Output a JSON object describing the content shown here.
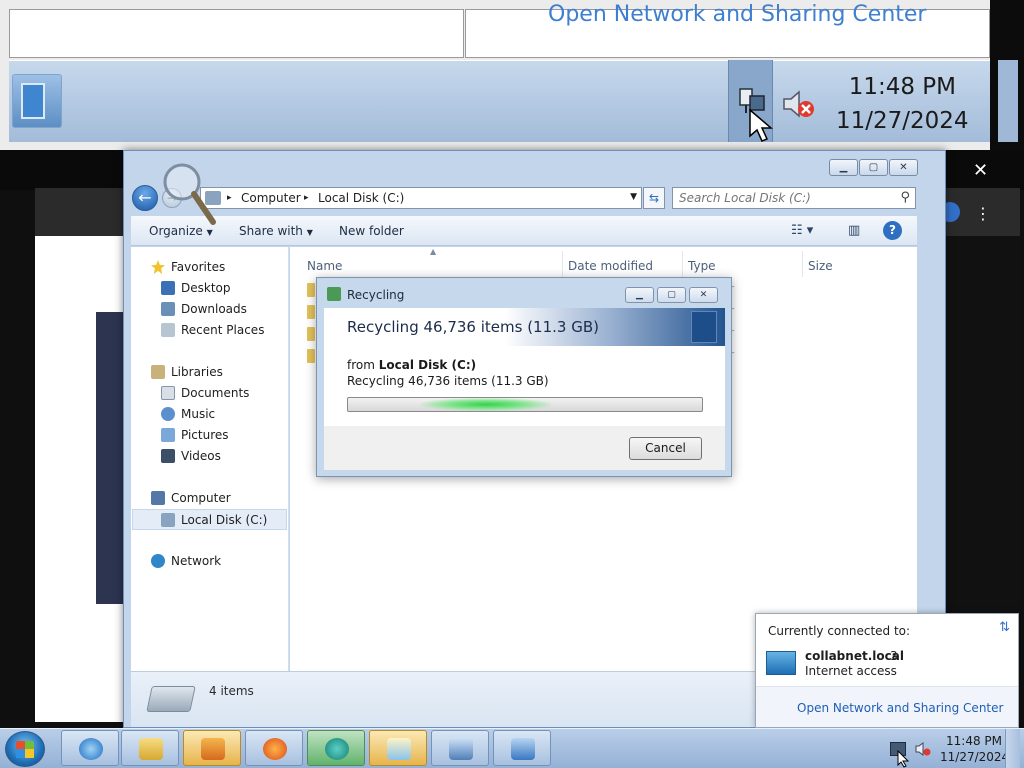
{
  "zoom": {
    "link_text": "Open Network and Sharing Center",
    "clock_time": "11:48 PM",
    "clock_date": "11/27/2024"
  },
  "explorer": {
    "breadcrumb": [
      "Computer",
      "Local Disk (C:)"
    ],
    "search_placeholder": "Search Local Disk (C:)",
    "toolbar": {
      "organize": "Organize",
      "share_with": "Share with",
      "new_folder": "New folder"
    },
    "nav": {
      "favorites": "Favorites",
      "desktop": "Desktop",
      "downloads": "Downloads",
      "recent_places": "Recent Places",
      "libraries": "Libraries",
      "documents": "Documents",
      "music": "Music",
      "pictures": "Pictures",
      "videos": "Videos",
      "computer": "Computer",
      "local_disk": "Local Disk (C:)",
      "network": "Network"
    },
    "columns": [
      "Name",
      "Date modified",
      "Type",
      "Size"
    ],
    "type_fragments": [
      "er",
      "er",
      "er",
      "er"
    ],
    "status": "4 items"
  },
  "dialog": {
    "title": "Recycling",
    "header": "Recycling 46,736 items (11.3 GB)",
    "from_label": "from",
    "from_source": "Local Disk (C:)",
    "detail": "Recycling 46,736 items (11.3 GB)",
    "progress_fraction": 0.15,
    "cancel": "Cancel"
  },
  "network_popup": {
    "heading": "Currently connected to:",
    "network_name": "collabnet.local",
    "network_number": "3",
    "status": "Internet access",
    "link": "Open Network and Sharing Center"
  },
  "taskbar": {
    "clock_time": "11:48 PM",
    "clock_date": "11/27/2024",
    "apps": [
      "internet-explorer",
      "file-explorer",
      "media-player",
      "firefox",
      "app-teal",
      "notepad-document",
      "remote-desktop",
      "control-panel"
    ]
  },
  "colors": {
    "accent_blue": "#1f5eb5",
    "progress_green": "#34d14a",
    "taskbar": "#a8c0df"
  }
}
